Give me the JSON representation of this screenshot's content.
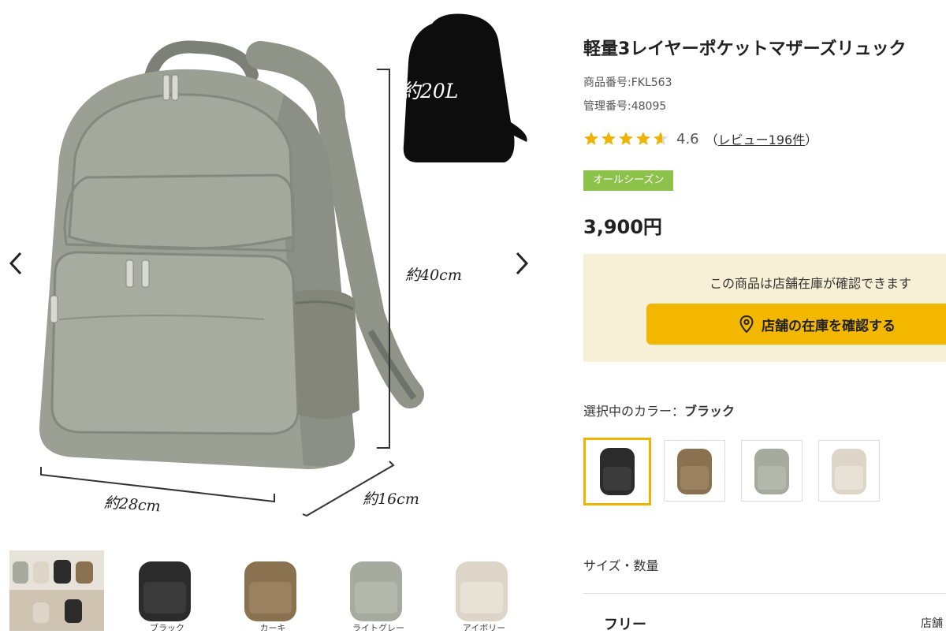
{
  "gallery": {
    "volume_label": "約20L",
    "height_label": "約40cm",
    "width_label": "約28cm",
    "depth_label": "約16cm",
    "thumbnails": [
      {
        "caption": "",
        "icon": "collage-thumbnail"
      },
      {
        "caption": "ブラック",
        "icon": "black-backpack"
      },
      {
        "caption": "カーキ",
        "icon": "khaki-backpack"
      },
      {
        "caption": "ライトグレー",
        "icon": "light-gray-backpack"
      },
      {
        "caption": "アイボリー",
        "icon": "ivory-backpack"
      }
    ]
  },
  "product": {
    "title": "軽量3レイヤーポケットマザーズリュック",
    "item_number": "商品番号:FKL563",
    "control_number": "管理番号:48095",
    "rating_value": "4.6",
    "rating_stars": 4.6,
    "review_open": "（",
    "review_link": "レビュー196件",
    "review_close": "）",
    "season_badge": "オールシーズン",
    "price": "3,900円"
  },
  "stock": {
    "note": "この商品は店舗在庫が確認できます",
    "button_label": "店舗の在庫を確認する",
    "icon": "map-pin-icon"
  },
  "colors": {
    "heading_prefix": "選択中のカラー：",
    "selected_name": "ブラック",
    "swatches": [
      {
        "name": "ブラック",
        "hex": "#2b2b2b"
      },
      {
        "name": "カーキ",
        "hex": "#8a7250"
      },
      {
        "name": "ライトグレー",
        "hex": "#a6aa9f"
      },
      {
        "name": "アイボリー",
        "hex": "#ddd6c8"
      }
    ]
  },
  "size": {
    "heading": "サイズ・数量",
    "option_name": "フリー",
    "right_text": "店舗"
  },
  "theme": {
    "accent": "#f3b700",
    "badge": "#8cc14a",
    "stock_bg": "#f7f0d6",
    "star": "#f0b400"
  }
}
